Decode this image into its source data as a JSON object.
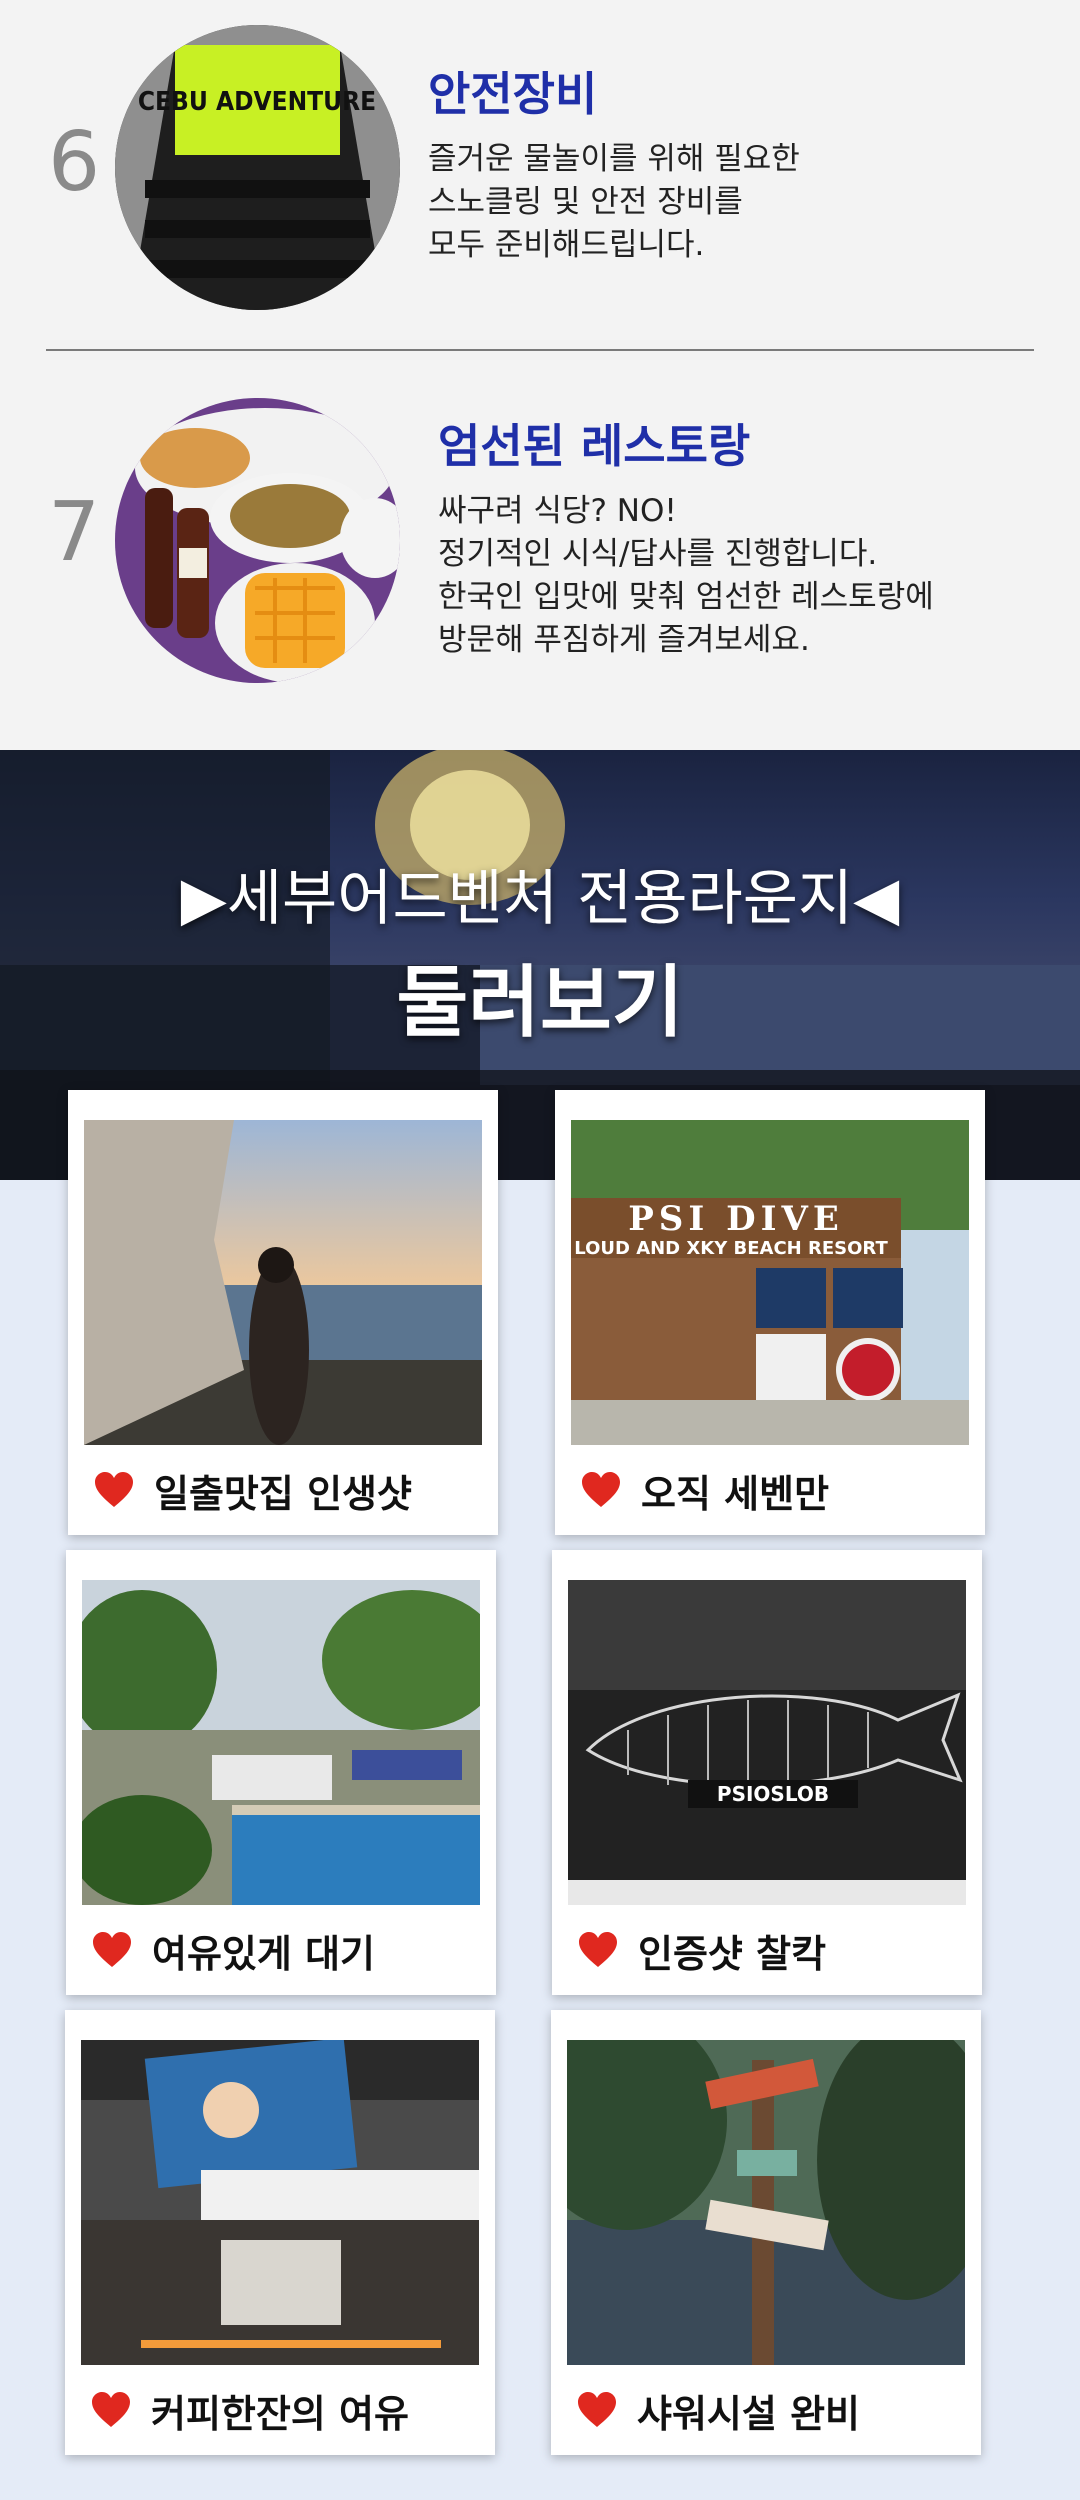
{
  "features": [
    {
      "number": "6",
      "title": "안전장비",
      "lines": [
        "즐거운 물놀이를 위해 필요한",
        "스노클링 및 안전 장비를",
        "모두 준비해드립니다."
      ],
      "vest_text": "CEBU ADVENTURE"
    },
    {
      "number": "7",
      "title": "엄선된 레스토랑",
      "lines": [
        "싸구려 식당? NO!",
        "정기적인 시식/답사를 진행합니다.",
        "한국인 입맛에 맞춰 엄선한 레스토랑에",
        "방문해 푸짐하게 즐겨보세요."
      ]
    }
  ],
  "banner": {
    "line1": "▶세부어드벤처 전용라운지◀",
    "line2": "둘러보기"
  },
  "gallery": [
    {
      "caption": "일출맛집 인생샷",
      "icon": "heart-icon"
    },
    {
      "caption": "오직 세벤만",
      "icon": "heart-icon",
      "sign_text": "PSI DIVE",
      "sign_sub": "LOUD AND XKY BEACH RESORT"
    },
    {
      "caption": "여유있게 대기",
      "icon": "heart-icon"
    },
    {
      "caption": "인증샷 찰칵",
      "icon": "heart-icon",
      "sign_text": "PSIOSLOB"
    },
    {
      "caption": "커피한잔의 여유",
      "icon": "heart-icon"
    },
    {
      "caption": "샤워시설 완비",
      "icon": "heart-icon"
    }
  ],
  "colors": {
    "title_blue": "#1f2fa8",
    "heart_red": "#e0281f",
    "page_bg": "#e4ebf7"
  }
}
